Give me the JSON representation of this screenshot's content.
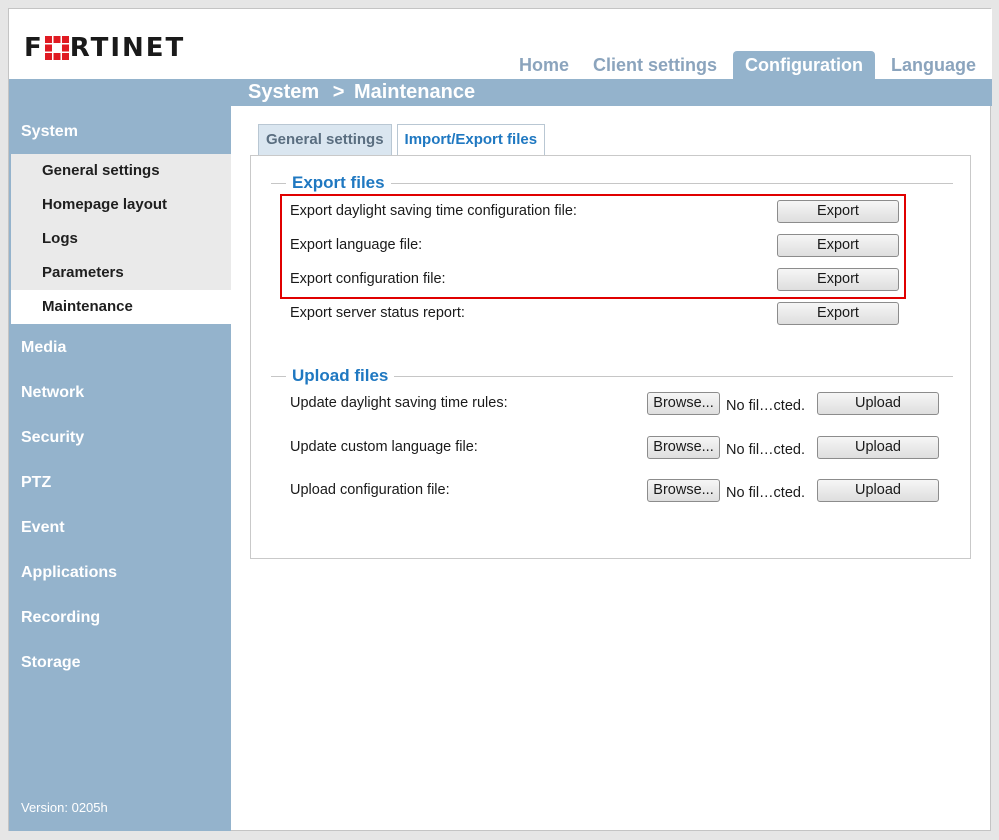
{
  "brand": {
    "name": "FORTINET",
    "accent": "#e01a22"
  },
  "topnav": {
    "tabs": [
      {
        "label": "Home",
        "active": false
      },
      {
        "label": "Client settings",
        "active": false
      },
      {
        "label": "Configuration",
        "active": true
      },
      {
        "label": "Language",
        "active": false
      }
    ]
  },
  "breadcrumb": {
    "section": "System",
    "separator": ">",
    "page": "Maintenance"
  },
  "sidebar": {
    "system_label": "System",
    "system_items": [
      {
        "label": "General settings",
        "active": false
      },
      {
        "label": "Homepage layout",
        "active": false
      },
      {
        "label": "Logs",
        "active": false
      },
      {
        "label": "Parameters",
        "active": false
      },
      {
        "label": "Maintenance",
        "active": true
      }
    ],
    "sections": [
      "Media",
      "Network",
      "Security",
      "PTZ",
      "Event",
      "Applications",
      "Recording",
      "Storage"
    ],
    "version": "Version: 0205h"
  },
  "subtabs": [
    {
      "label": "General settings",
      "active": true
    },
    {
      "label": "Import/Export files",
      "active": false
    }
  ],
  "export": {
    "title": "Export files",
    "button_label": "Export",
    "rows": [
      "Export daylight saving time configuration file:",
      "Export language file:",
      "Export configuration file:",
      "Export server status report:"
    ]
  },
  "upload": {
    "title": "Upload files",
    "browse_label": "Browse...",
    "file_status": "No fil…cted.",
    "button_label": "Upload",
    "rows": [
      "Update daylight saving time rules:",
      "Update custom language file:",
      "Upload configuration file:"
    ]
  },
  "colors": {
    "nav_bg": "#94b3cc",
    "link_blue": "#1f78c1",
    "highlight_red": "#e00000"
  }
}
